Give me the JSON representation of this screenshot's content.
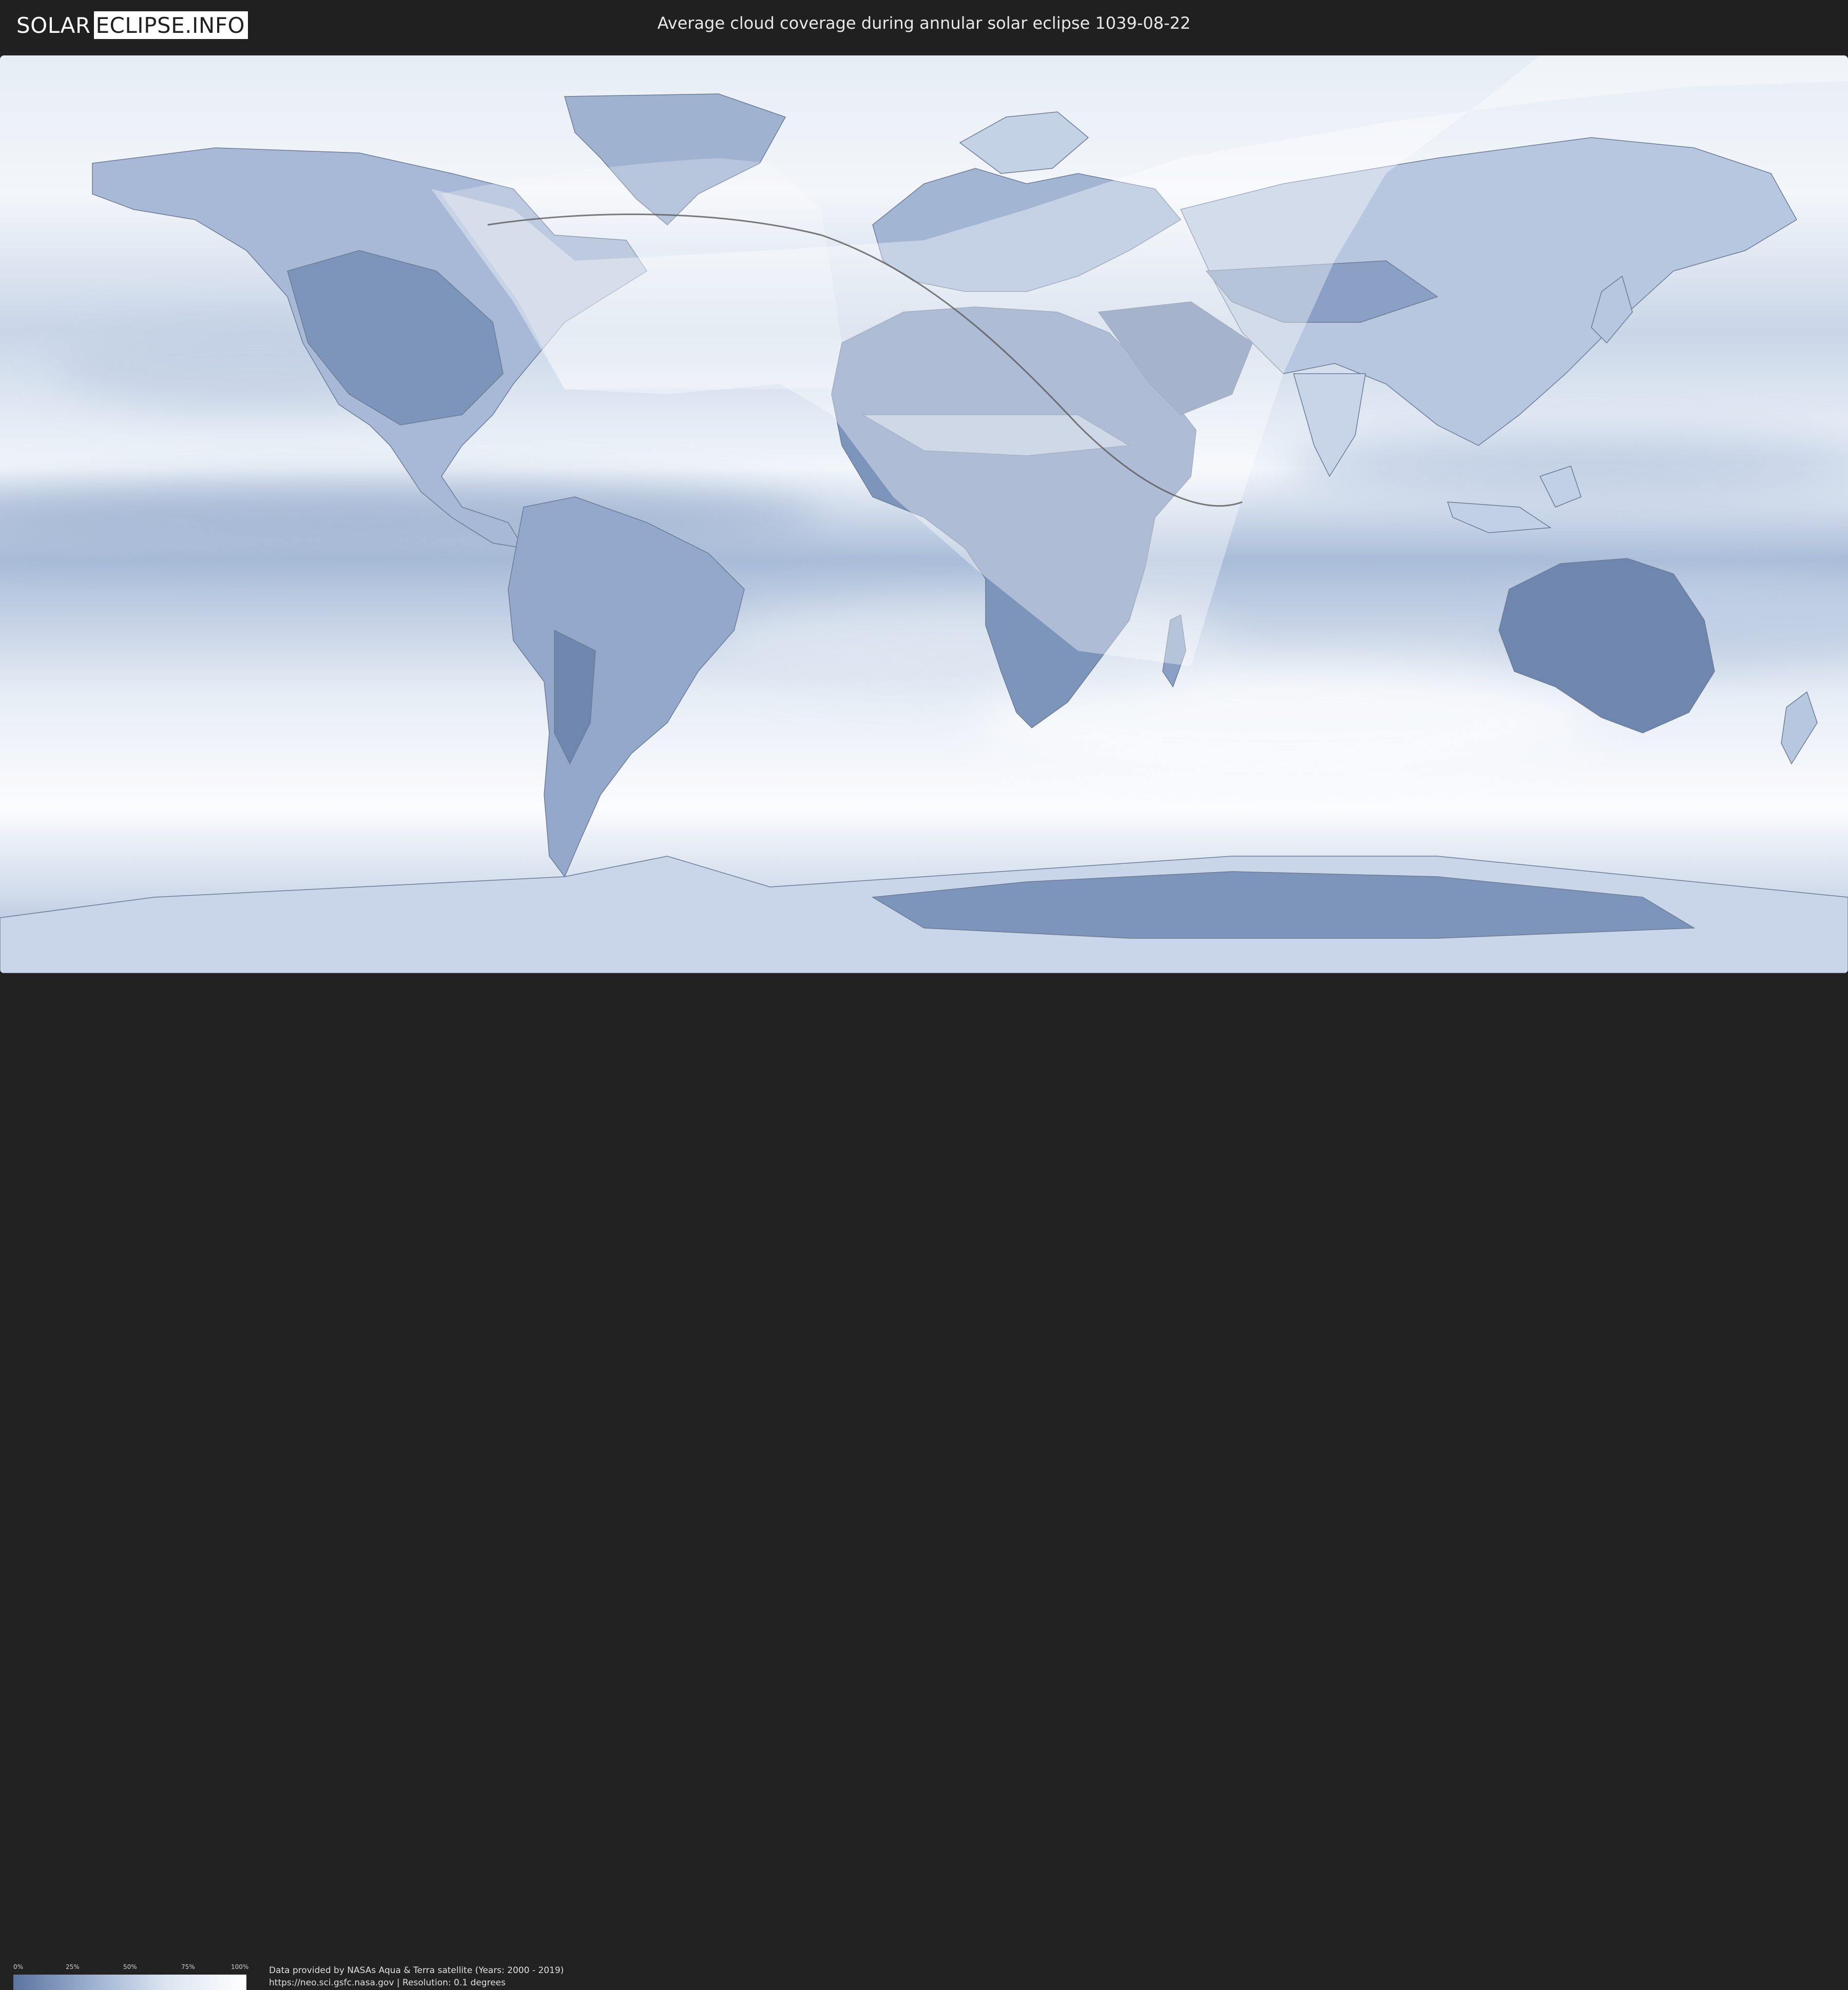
{
  "header": {
    "logo_left": "SOLAR",
    "logo_right": "ECLIPSE.INFO",
    "title": "Average cloud coverage during annular solar eclipse 1039-08-22"
  },
  "legend": {
    "ticks": [
      "0%",
      "25%",
      "50%",
      "75%",
      "100%"
    ],
    "gradient_colors": [
      "#5b74a0",
      "#9fb3d2",
      "#dbe4f1",
      "#ffffff"
    ]
  },
  "credits": {
    "line1": "Data provided by NASAs Aqua & Terra satellite (Years: 2000 - 2019)",
    "line2": "https://neo.sci.gsfc.nasa.gov | Resolution: 0.1 degrees"
  },
  "map": {
    "projection": "equirectangular",
    "colors": {
      "clear_sky": "#5b74a0",
      "cloudy": "#ffffff",
      "eclipse_overlay": "#ffffff",
      "central_line": "#555555",
      "borders": "#7a8aa3"
    }
  }
}
